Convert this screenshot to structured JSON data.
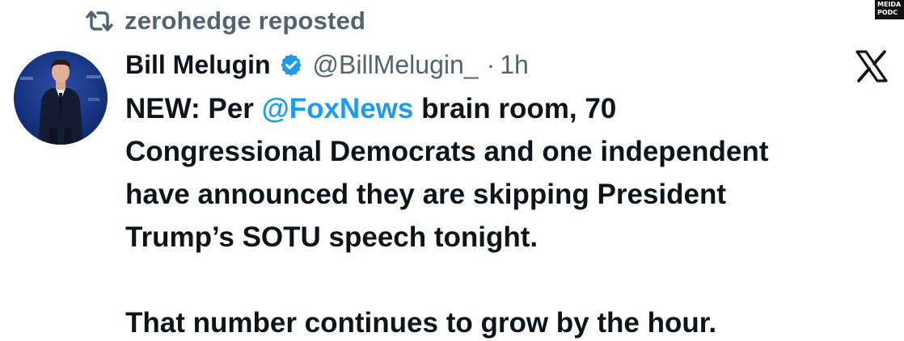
{
  "repost": {
    "icon": "repost-icon",
    "text": "zerohedge reposted"
  },
  "watermark": {
    "line1": "MEIDA",
    "line2": "PODC"
  },
  "tweet": {
    "author_name": "Bill Melugin",
    "verified": true,
    "handle": "@BillMelugin_",
    "separator": "·",
    "time": "1h",
    "line1_prefix": "NEW: Per ",
    "line1_mention": "@FoxNews",
    "line1_suffix": " brain room, 70",
    "line2": "Congressional Democrats and one independent",
    "line3": "have announced they are skipping President",
    "line4": "Trump’s SOTU speech tonight.",
    "line5": "That number continues to grow by the hour."
  },
  "colors": {
    "text": "#0f1419",
    "muted": "#536471",
    "link": "#1d9bf0",
    "verified": "#1d9bf0"
  },
  "icons": {
    "verified": "verified-badge-icon",
    "platform": "x-logo-icon"
  }
}
